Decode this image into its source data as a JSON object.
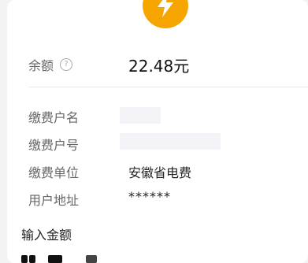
{
  "balance": {
    "label": "余额",
    "help_icon": "question-circle-icon",
    "value": "22.48元"
  },
  "account": {
    "name_label": "缴费户名",
    "name_value": "",
    "number_label": "缴费户号",
    "number_value": "",
    "company_label": "缴费单位",
    "company_value": "安徽省电费",
    "address_label": "用户地址",
    "address_value": "******"
  },
  "amount": {
    "title": "输入金额"
  },
  "colors": {
    "accent": "#f6a400"
  },
  "icons": {
    "badge": "lightning-bolt-icon"
  }
}
